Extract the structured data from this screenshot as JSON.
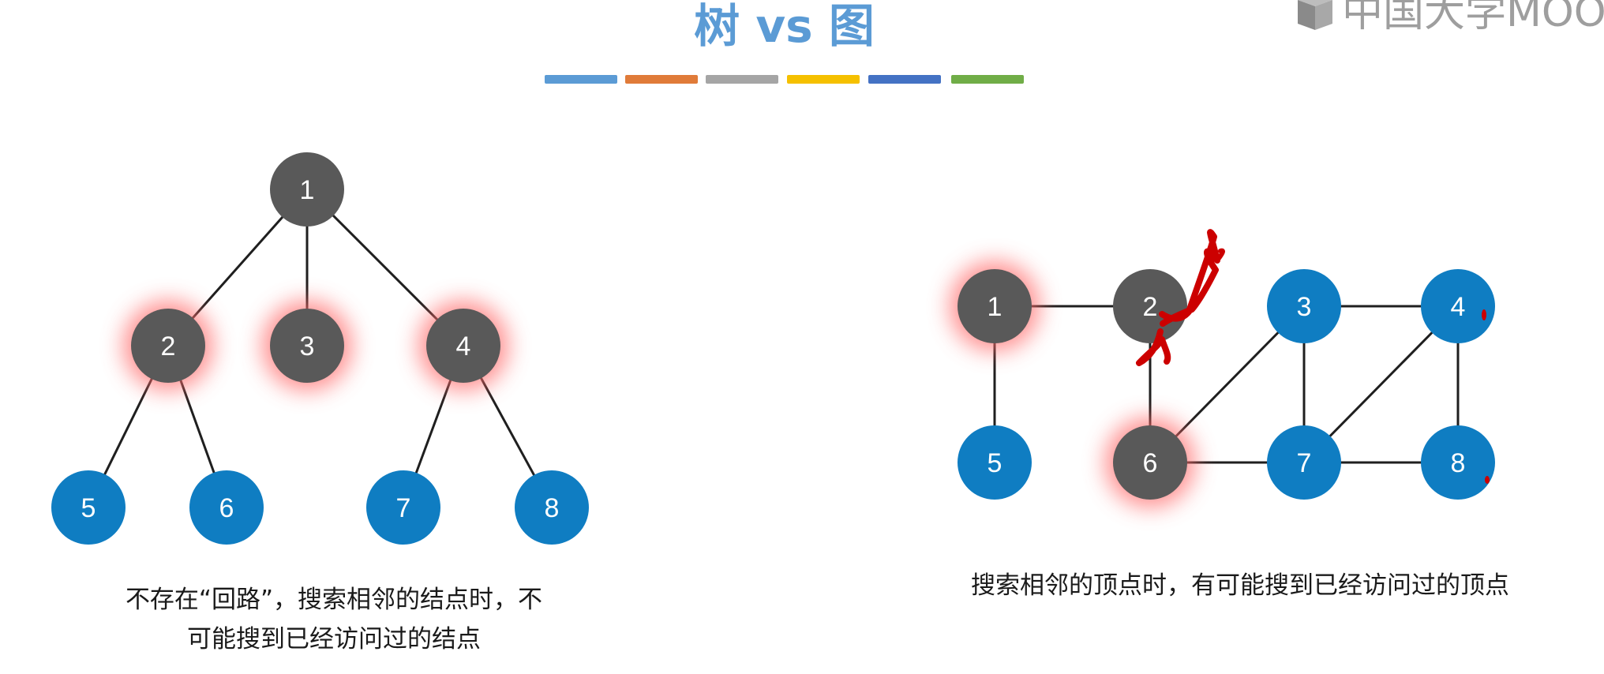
{
  "title": "树 vs 图",
  "logo_text": "中国大学MOOC",
  "palette_bars": [
    "#5b9bd5",
    "#e07b39",
    "#a5a5a5",
    "#f5c000",
    "#4472c4",
    "#70ad47"
  ],
  "colors": {
    "gray_node": "#595959",
    "blue_node": "#0f7dc2",
    "highlight": "#ff6b6b",
    "annotation": "#cc0000"
  },
  "tree": {
    "nodes": [
      {
        "id": "1",
        "label": "1",
        "color": "gray",
        "highlight": false
      },
      {
        "id": "2",
        "label": "2",
        "color": "gray",
        "highlight": true
      },
      {
        "id": "3",
        "label": "3",
        "color": "gray",
        "highlight": true
      },
      {
        "id": "4",
        "label": "4",
        "color": "gray",
        "highlight": true
      },
      {
        "id": "5",
        "label": "5",
        "color": "blue",
        "highlight": false
      },
      {
        "id": "6",
        "label": "6",
        "color": "blue",
        "highlight": false
      },
      {
        "id": "7",
        "label": "7",
        "color": "blue",
        "highlight": false
      },
      {
        "id": "8",
        "label": "8",
        "color": "blue",
        "highlight": false
      }
    ],
    "edges": [
      [
        "1",
        "2"
      ],
      [
        "1",
        "3"
      ],
      [
        "1",
        "4"
      ],
      [
        "2",
        "5"
      ],
      [
        "2",
        "6"
      ],
      [
        "4",
        "7"
      ],
      [
        "4",
        "8"
      ]
    ],
    "caption_line1": "不存在“回路”，搜索相邻的结点时，不",
    "caption_line2": "可能搜到已经访问过的结点"
  },
  "graph": {
    "nodes": [
      {
        "id": "1",
        "label": "1",
        "color": "gray",
        "highlight": true
      },
      {
        "id": "2",
        "label": "2",
        "color": "gray",
        "highlight": false
      },
      {
        "id": "3",
        "label": "3",
        "color": "blue",
        "highlight": false
      },
      {
        "id": "4",
        "label": "4",
        "color": "blue",
        "highlight": false
      },
      {
        "id": "5",
        "label": "5",
        "color": "blue",
        "highlight": false
      },
      {
        "id": "6",
        "label": "6",
        "color": "gray",
        "highlight": true
      },
      {
        "id": "7",
        "label": "7",
        "color": "blue",
        "highlight": false
      },
      {
        "id": "8",
        "label": "8",
        "color": "blue",
        "highlight": false
      }
    ],
    "edges": [
      [
        "1",
        "2"
      ],
      [
        "1",
        "5"
      ],
      [
        "2",
        "6"
      ],
      [
        "3",
        "4"
      ],
      [
        "3",
        "6"
      ],
      [
        "3",
        "7"
      ],
      [
        "4",
        "7"
      ],
      [
        "4",
        "8"
      ],
      [
        "6",
        "7"
      ],
      [
        "7",
        "8"
      ]
    ],
    "caption": "搜索相邻的顶点时，有可能搜到已经访问过的顶点"
  }
}
